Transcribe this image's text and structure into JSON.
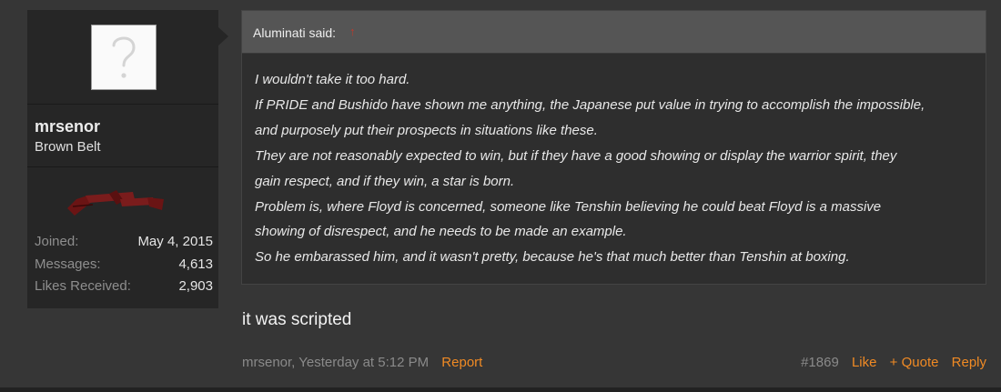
{
  "user": {
    "username": "mrsenor",
    "title": "Brown Belt",
    "stats": [
      {
        "label": "Joined:",
        "value": "May 4, 2015"
      },
      {
        "label": "Messages:",
        "value": "4,613"
      },
      {
        "label": "Likes Received:",
        "value": "2,903"
      }
    ]
  },
  "quote": {
    "author": "Aluminati said:",
    "lines": [
      "I wouldn't take it too hard.",
      "If PRIDE and Bushido have shown me anything, the Japanese put value in trying to accomplish the impossible,",
      "and purposely put their prospects in situations like these.",
      "They are not reasonably expected to win, but if they have a good showing or display the warrior spirit, they",
      "gain respect, and if they win, a star is born.",
      "Problem is, where Floyd is concerned, someone like Tenshin believing he could beat Floyd is a massive",
      "showing of disrespect, and he needs to be made an example.",
      "So he embarassed him, and it wasn't pretty, because he's that much better than Tenshin at boxing."
    ]
  },
  "message": "it was scripted",
  "meta": {
    "author_time": "mrsenor, Yesterday at 5:12 PM",
    "report": "Report",
    "post_number": "#1869",
    "like": "Like",
    "quote": "+ Quote",
    "reply": "Reply"
  },
  "colors": {
    "background": "#363636",
    "panel": "#262626",
    "accent": "#f08a24"
  }
}
